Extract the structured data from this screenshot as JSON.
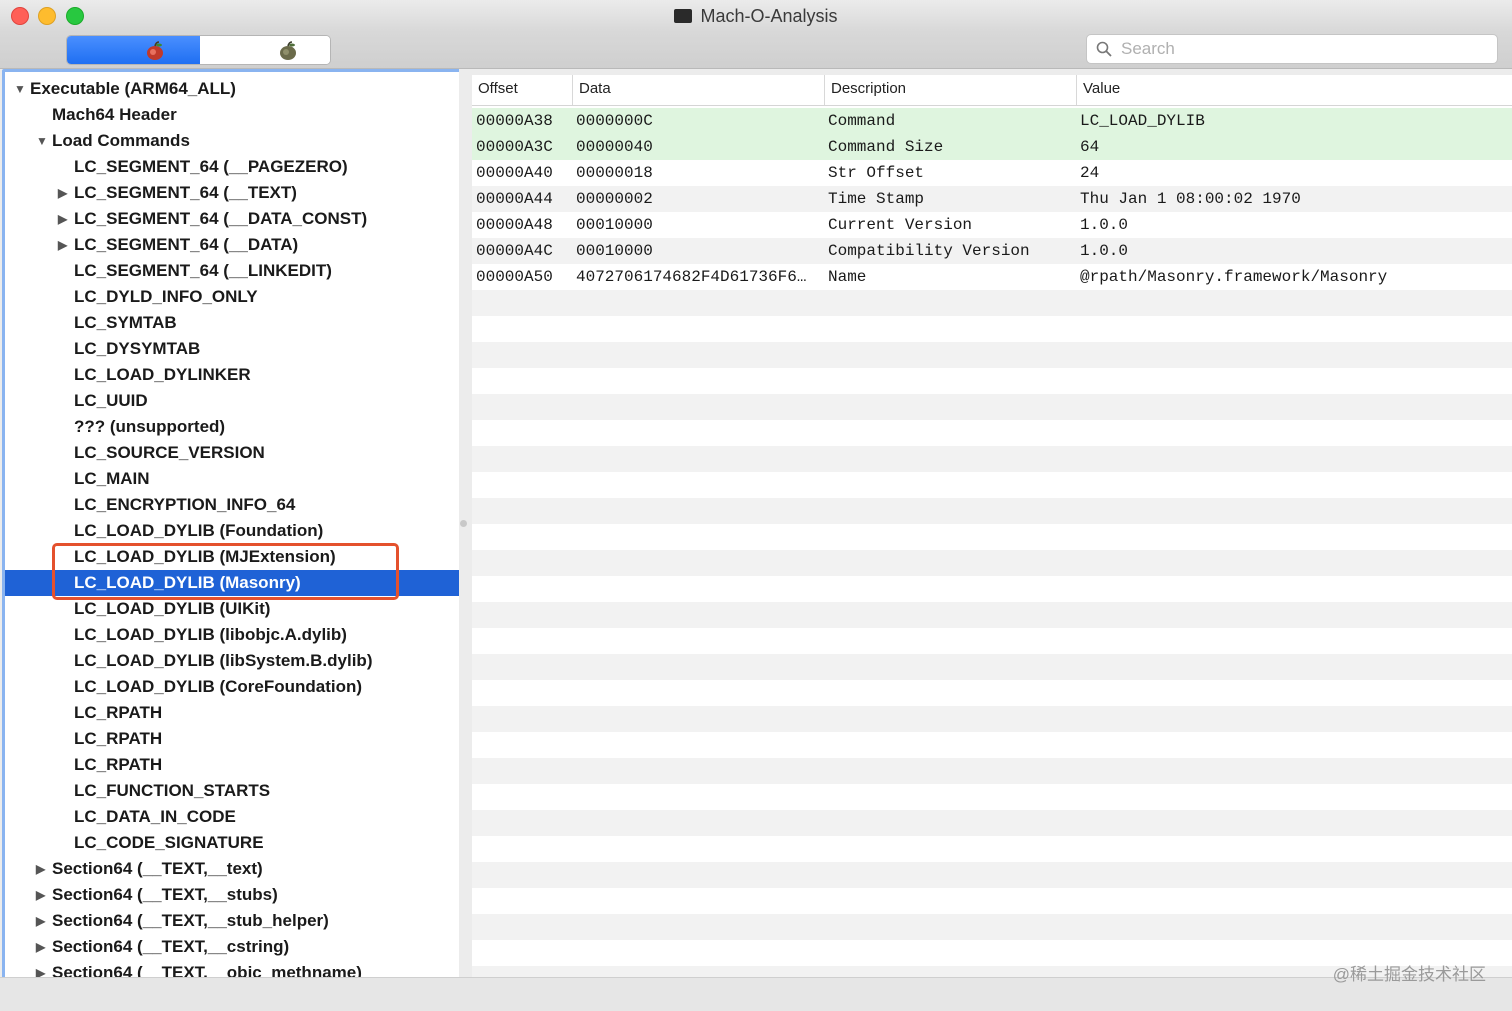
{
  "window": {
    "title": "Mach-O-Analysis"
  },
  "search": {
    "placeholder": "Search"
  },
  "sidebar": {
    "items": [
      {
        "label": "Executable  (ARM64_ALL)",
        "level": 0,
        "disclosure": "open"
      },
      {
        "label": "Mach64 Header",
        "level": 1,
        "disclosure": "none"
      },
      {
        "label": "Load Commands",
        "level": 1,
        "disclosure": "open"
      },
      {
        "label": "LC_SEGMENT_64 (__PAGEZERO)",
        "level": 2,
        "disclosure": "none"
      },
      {
        "label": "LC_SEGMENT_64 (__TEXT)",
        "level": 2,
        "disclosure": "closed"
      },
      {
        "label": "LC_SEGMENT_64 (__DATA_CONST)",
        "level": 2,
        "disclosure": "closed"
      },
      {
        "label": "LC_SEGMENT_64 (__DATA)",
        "level": 2,
        "disclosure": "closed"
      },
      {
        "label": "LC_SEGMENT_64 (__LINKEDIT)",
        "level": 2,
        "disclosure": "none"
      },
      {
        "label": "LC_DYLD_INFO_ONLY",
        "level": 2,
        "disclosure": "none"
      },
      {
        "label": "LC_SYMTAB",
        "level": 2,
        "disclosure": "none"
      },
      {
        "label": "LC_DYSYMTAB",
        "level": 2,
        "disclosure": "none"
      },
      {
        "label": "LC_LOAD_DYLINKER",
        "level": 2,
        "disclosure": "none"
      },
      {
        "label": "LC_UUID",
        "level": 2,
        "disclosure": "none"
      },
      {
        "label": "??? (unsupported)",
        "level": 2,
        "disclosure": "none"
      },
      {
        "label": "LC_SOURCE_VERSION",
        "level": 2,
        "disclosure": "none"
      },
      {
        "label": "LC_MAIN",
        "level": 2,
        "disclosure": "none"
      },
      {
        "label": "LC_ENCRYPTION_INFO_64",
        "level": 2,
        "disclosure": "none"
      },
      {
        "label": "LC_LOAD_DYLIB (Foundation)",
        "level": 2,
        "disclosure": "none"
      },
      {
        "label": "LC_LOAD_DYLIB (MJExtension)",
        "level": 2,
        "disclosure": "none"
      },
      {
        "label": "LC_LOAD_DYLIB (Masonry)",
        "level": 2,
        "disclosure": "none",
        "selected": true
      },
      {
        "label": "LC_LOAD_DYLIB (UIKit)",
        "level": 2,
        "disclosure": "none"
      },
      {
        "label": "LC_LOAD_DYLIB (libobjc.A.dylib)",
        "level": 2,
        "disclosure": "none"
      },
      {
        "label": "LC_LOAD_DYLIB (libSystem.B.dylib)",
        "level": 2,
        "disclosure": "none"
      },
      {
        "label": "LC_LOAD_DYLIB (CoreFoundation)",
        "level": 2,
        "disclosure": "none"
      },
      {
        "label": "LC_RPATH",
        "level": 2,
        "disclosure": "none"
      },
      {
        "label": "LC_RPATH",
        "level": 2,
        "disclosure": "none"
      },
      {
        "label": "LC_RPATH",
        "level": 2,
        "disclosure": "none"
      },
      {
        "label": "LC_FUNCTION_STARTS",
        "level": 2,
        "disclosure": "none"
      },
      {
        "label": "LC_DATA_IN_CODE",
        "level": 2,
        "disclosure": "none"
      },
      {
        "label": "LC_CODE_SIGNATURE",
        "level": 2,
        "disclosure": "none"
      },
      {
        "label": "Section64 (__TEXT,__text)",
        "level": 1,
        "disclosure": "closed"
      },
      {
        "label": "Section64 (__TEXT,__stubs)",
        "level": 1,
        "disclosure": "closed"
      },
      {
        "label": "Section64 (__TEXT,__stub_helper)",
        "level": 1,
        "disclosure": "closed"
      },
      {
        "label": "Section64 (__TEXT,__cstring)",
        "level": 1,
        "disclosure": "closed"
      },
      {
        "label": "Section64 (__TEXT,__objc_methname)",
        "level": 1,
        "disclosure": "closed"
      }
    ]
  },
  "table": {
    "columns": [
      "Offset",
      "Data",
      "Description",
      "Value"
    ],
    "rows": [
      {
        "offset": "00000A38",
        "data": "0000000C",
        "description": "Command",
        "value": "LC_LOAD_DYLIB",
        "highlight": true
      },
      {
        "offset": "00000A3C",
        "data": "00000040",
        "description": "Command Size",
        "value": "64",
        "highlight": true
      },
      {
        "offset": "00000A40",
        "data": "00000018",
        "description": "Str Offset",
        "value": "24"
      },
      {
        "offset": "00000A44",
        "data": "00000002",
        "description": "Time Stamp",
        "value": "Thu Jan  1 08:00:02 1970"
      },
      {
        "offset": "00000A48",
        "data": "00010000",
        "description": "Current Version",
        "value": "1.0.0"
      },
      {
        "offset": "00000A4C",
        "data": "00010000",
        "description": "Compatibility Version",
        "value": "1.0.0"
      },
      {
        "offset": "00000A50",
        "data": "4072706174682F4D61736F6…",
        "description": "Name",
        "value": "@rpath/Masonry.framework/Masonry"
      }
    ]
  },
  "watermark": "@稀土掘金技术社区",
  "colors": {
    "selection": "#1f62d6",
    "row_highlight": "#dff5df",
    "annotation_box": "#e4512d",
    "focus_ring": "#8ab4f0"
  },
  "icons": {
    "toolbar_left": "apple-icon",
    "toolbar_right": "apple-icon",
    "search": "search-icon"
  }
}
